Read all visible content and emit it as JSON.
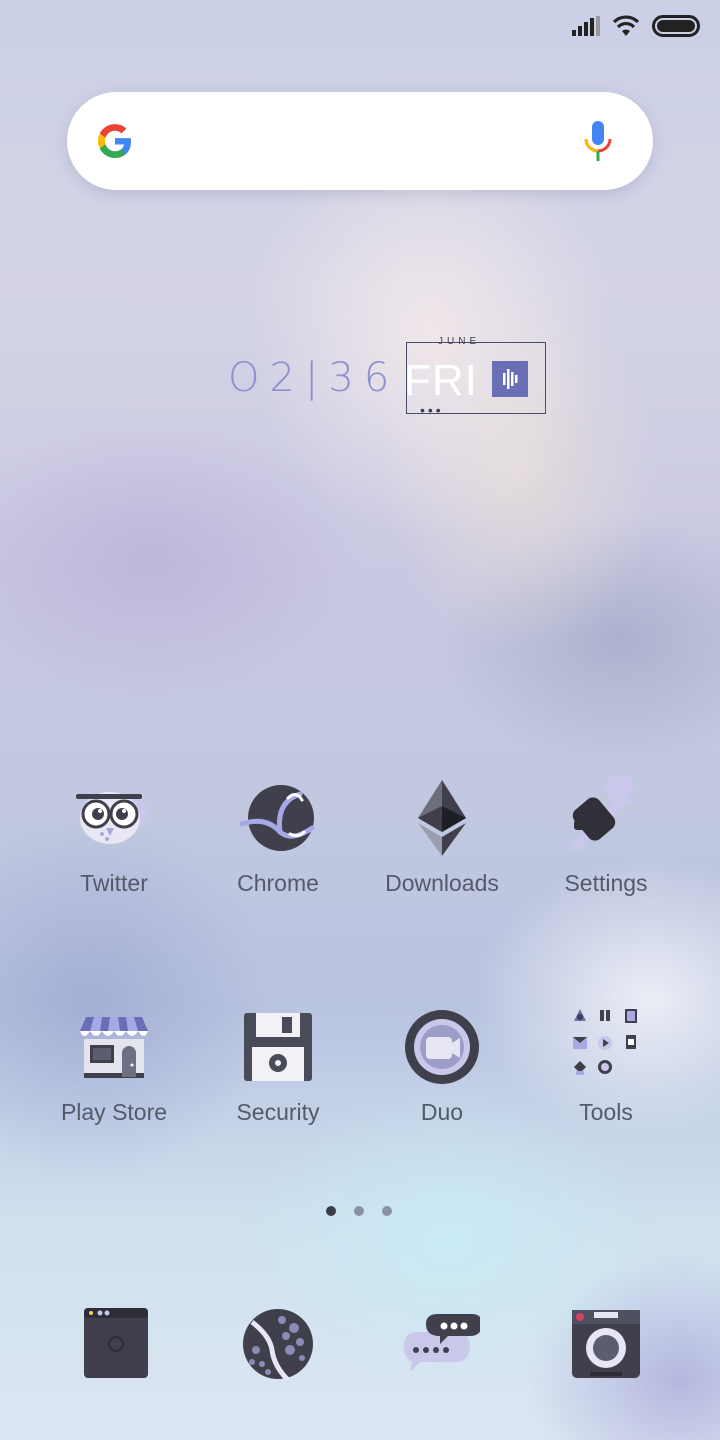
{
  "status_bar": {
    "signal_icon": "signal-icon",
    "wifi_icon": "wifi-icon",
    "battery_icon": "battery-icon"
  },
  "search_bar": {
    "logo_icon": "google-logo-icon",
    "mic_icon": "mic-icon"
  },
  "clock_widget": {
    "time": "O2|36",
    "month": "JUNE",
    "day": "FRI",
    "dots": "•••"
  },
  "apps": [
    {
      "label": "Twitter",
      "icon": "owl-icon"
    },
    {
      "label": "Chrome",
      "icon": "chrome-icon"
    },
    {
      "label": "Downloads",
      "icon": "ethereum-icon"
    },
    {
      "label": "Settings",
      "icon": "wrench-icon"
    },
    {
      "label": "Play Store",
      "icon": "store-icon"
    },
    {
      "label": "Security",
      "icon": "floppy-icon"
    },
    {
      "label": "Duo",
      "icon": "video-camera-icon"
    },
    {
      "label": "Tools",
      "icon": "folder-grid-icon"
    }
  ],
  "page_indicator": {
    "count": 3,
    "active": 0
  },
  "dock": [
    {
      "icon": "phone-icon"
    },
    {
      "icon": "map-icon"
    },
    {
      "icon": "messages-icon"
    },
    {
      "icon": "camera-icon"
    }
  ],
  "colors": {
    "accent": "#8d8fd0",
    "label": "#555a6a",
    "dark_icon": "#3f404c",
    "lavender": "#b9bce8"
  }
}
